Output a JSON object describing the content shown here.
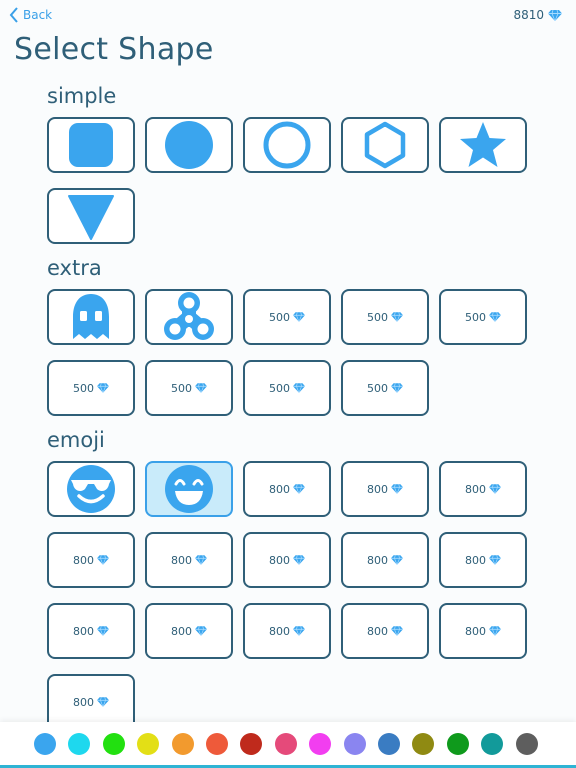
{
  "header": {
    "back_label": "Back",
    "gem_count": "8810",
    "title": "Select Shape"
  },
  "sections": [
    {
      "id": "simple",
      "title": "simple",
      "tiles": [
        {
          "type": "shape",
          "icon": "rounded-square-icon"
        },
        {
          "type": "shape",
          "icon": "circle-icon"
        },
        {
          "type": "shape",
          "icon": "ring-icon"
        },
        {
          "type": "shape",
          "icon": "hexagon-outline-icon"
        },
        {
          "type": "shape",
          "icon": "star-icon"
        },
        {
          "type": "shape",
          "icon": "triangle-down-icon"
        }
      ]
    },
    {
      "id": "extra",
      "title": "extra",
      "tiles": [
        {
          "type": "shape",
          "icon": "ghost-icon"
        },
        {
          "type": "shape",
          "icon": "fidget-spinner-icon"
        },
        {
          "type": "locked",
          "price": "500"
        },
        {
          "type": "locked",
          "price": "500"
        },
        {
          "type": "locked",
          "price": "500"
        },
        {
          "type": "locked",
          "price": "500"
        },
        {
          "type": "locked",
          "price": "500"
        },
        {
          "type": "locked",
          "price": "500"
        },
        {
          "type": "locked",
          "price": "500"
        }
      ]
    },
    {
      "id": "emoji",
      "title": "emoji",
      "tiles": [
        {
          "type": "shape",
          "icon": "sunglasses-emoji-icon"
        },
        {
          "type": "shape",
          "icon": "grinning-emoji-icon",
          "selected": true
        },
        {
          "type": "locked",
          "price": "800"
        },
        {
          "type": "locked",
          "price": "800"
        },
        {
          "type": "locked",
          "price": "800"
        },
        {
          "type": "locked",
          "price": "800"
        },
        {
          "type": "locked",
          "price": "800"
        },
        {
          "type": "locked",
          "price": "800"
        },
        {
          "type": "locked",
          "price": "800"
        },
        {
          "type": "locked",
          "price": "800"
        },
        {
          "type": "locked",
          "price": "800"
        },
        {
          "type": "locked",
          "price": "800"
        },
        {
          "type": "locked",
          "price": "800"
        },
        {
          "type": "locked",
          "price": "800"
        },
        {
          "type": "locked",
          "price": "800"
        },
        {
          "type": "locked",
          "price": "800"
        }
      ]
    }
  ],
  "colors": {
    "accent": "#3aa0e8",
    "shape_fill": "#3aa5ee",
    "border": "#2f5f78",
    "selected_bg": "#c9ebfa"
  },
  "palette": [
    {
      "name": "blue",
      "color": "#3aa5ee",
      "selected": true
    },
    {
      "name": "cyan",
      "color": "#1ed8ee"
    },
    {
      "name": "green",
      "color": "#22e010"
    },
    {
      "name": "yellow",
      "color": "#e3df16"
    },
    {
      "name": "orange",
      "color": "#f29a2e"
    },
    {
      "name": "red-orange",
      "color": "#ee5a3a"
    },
    {
      "name": "dark-red",
      "color": "#bf2a1c"
    },
    {
      "name": "pink",
      "color": "#e54a7a"
    },
    {
      "name": "magenta",
      "color": "#f23ef0"
    },
    {
      "name": "lavender",
      "color": "#8a85f0"
    },
    {
      "name": "steel-blue",
      "color": "#3a7cc2"
    },
    {
      "name": "olive",
      "color": "#8f8a12"
    },
    {
      "name": "dark-green",
      "color": "#0f9a1c"
    },
    {
      "name": "teal",
      "color": "#129a9a"
    },
    {
      "name": "gray",
      "color": "#5e5e5e"
    }
  ]
}
